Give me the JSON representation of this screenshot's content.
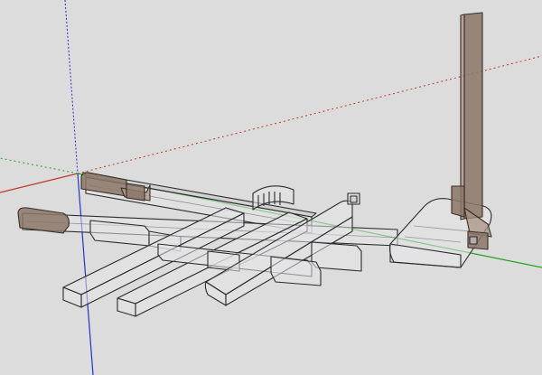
{
  "viewport": {
    "background": "#dcdcdc",
    "axes": {
      "red": "#c0392b",
      "green": "#1fa31f",
      "blue": "#2233cc"
    },
    "model": {
      "glass_color": "#e6e6e8",
      "edge_color": "#2b2b2b",
      "brown_color": "#8a7566"
    }
  }
}
